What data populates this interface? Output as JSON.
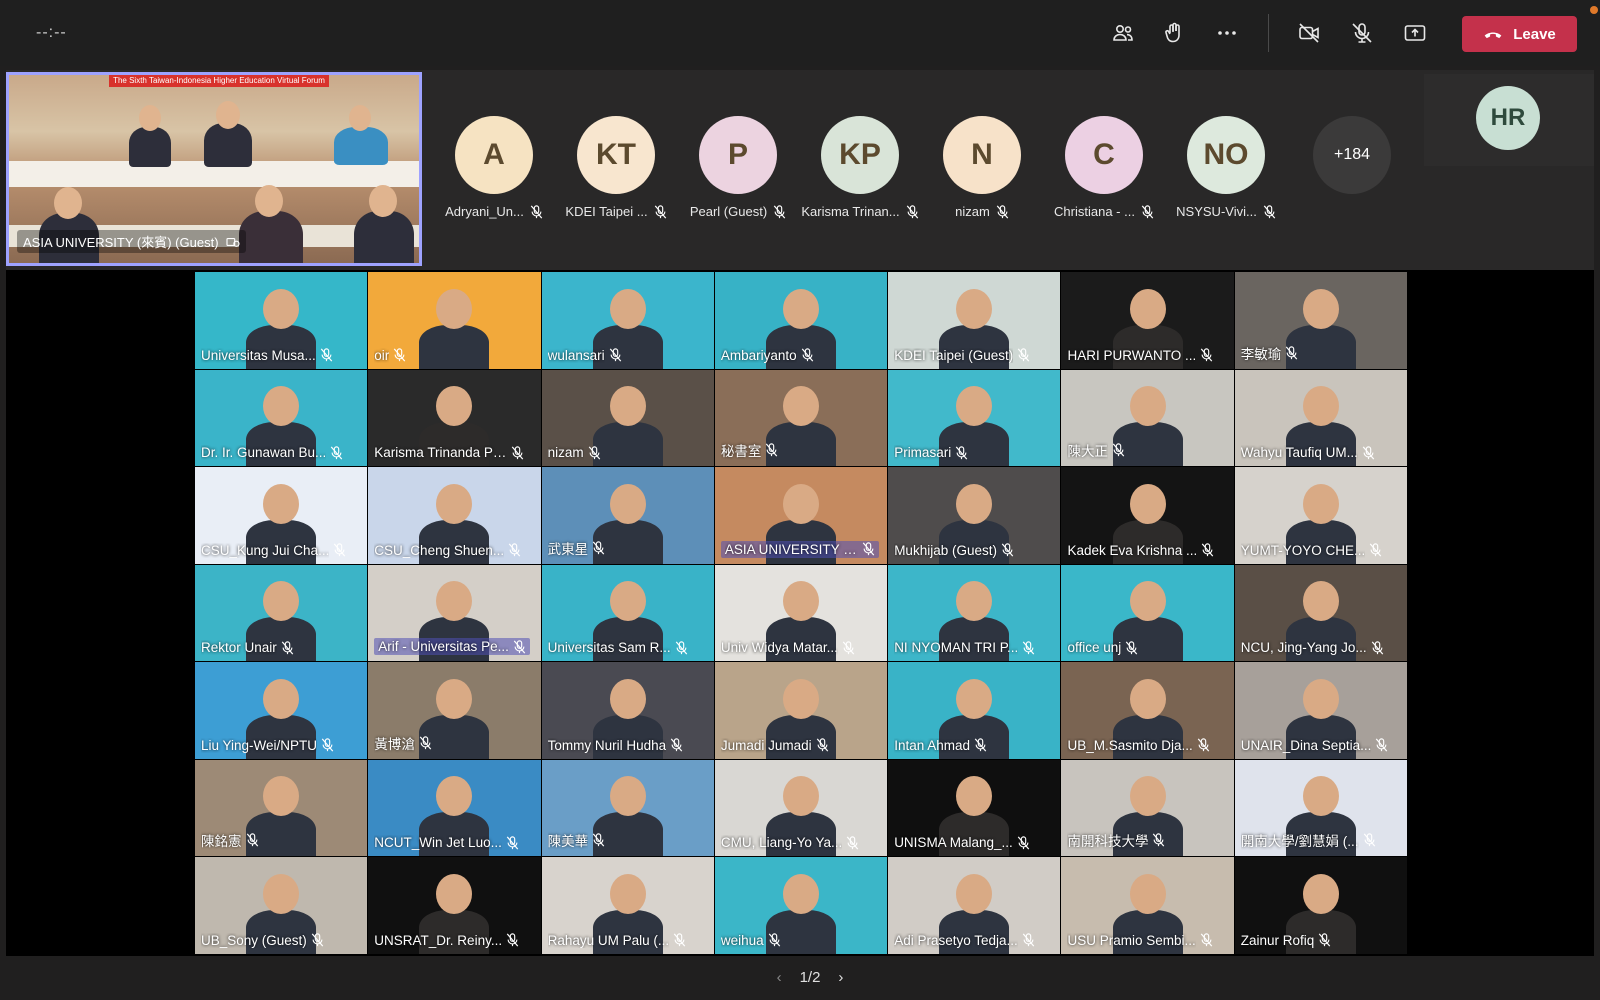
{
  "meeting": {
    "timer": "--:--",
    "leave_label": "Leave",
    "colors": {
      "leave": "#c4314b",
      "featured_border": "#9ea2ff"
    },
    "toolbar_icons": [
      "people-icon",
      "reactions-icon",
      "more-icon",
      "camera-off-icon",
      "mic-off-icon",
      "share-icon"
    ]
  },
  "featured": {
    "banner": "The Sixth Taiwan-Indonesia Higher Education Virtual Forum",
    "label": "ASIA UNIVERSITY (來賓) (Guest)"
  },
  "avatars": [
    {
      "initials": "A",
      "name": "Adryani_Un...",
      "color": "#f6e3c2"
    },
    {
      "initials": "KT",
      "name": "KDEI Taipei ...",
      "color": "#f8e6cf"
    },
    {
      "initials": "P",
      "name": "Pearl (Guest)",
      "color": "#ecd3e0"
    },
    {
      "initials": "KP",
      "name": "Karisma Trinan...",
      "color": "#d9e4d8"
    },
    {
      "initials": "N",
      "name": "nizam",
      "color": "#f7e2c9"
    },
    {
      "initials": "C",
      "name": "Christiana - ...",
      "color": "#ecd0e3"
    },
    {
      "initials": "NO",
      "name": "NSYSU-Vivi...",
      "color": "#dde9dd"
    }
  ],
  "more_count": "+184",
  "self": {
    "initials": "HR"
  },
  "tiles": [
    {
      "name": "Universitas Musa...",
      "bg": "#35b7c9"
    },
    {
      "name": "oir",
      "bg": "#f2a93b"
    },
    {
      "name": "wulansari",
      "bg": "#3bb5cc"
    },
    {
      "name": "Ambariyanto",
      "bg": "#37b2c6"
    },
    {
      "name": "KDEI Taipei (Guest)",
      "bg": "#cfd8d4"
    },
    {
      "name": "HARI PURWANTO ...",
      "bg": "#1b1b1b"
    },
    {
      "name": "李敏瑜",
      "bg": "#6a6560"
    },
    {
      "name": "Dr. Ir. Gunawan Bu...",
      "bg": "#3ab4c9"
    },
    {
      "name": "Karisma Trinanda Pu...",
      "bg": "#2a2a2a"
    },
    {
      "name": "nizam",
      "bg": "#5a5048"
    },
    {
      "name": "秘書室",
      "bg": "#8a6e58"
    },
    {
      "name": "Primasari",
      "bg": "#41b9cb"
    },
    {
      "name": "陳大正",
      "bg": "#c8c6c0"
    },
    {
      "name": "Wahyu Taufiq UM...",
      "bg": "#c9c4bc"
    },
    {
      "name": "CSU_Kung Jui Cha...",
      "bg": "#e9eef6"
    },
    {
      "name": "CSU_Cheng Shuen...",
      "bg": "#c9d6ea"
    },
    {
      "name": "武東星",
      "bg": "#5d8fb8"
    },
    {
      "name": "ASIA UNIVERSITY (...",
      "bg": "#c58a60",
      "boxed": true
    },
    {
      "name": "Mukhijab (Guest)",
      "bg": "#4f4c4c"
    },
    {
      "name": "Kadek Eva Krishna ...",
      "bg": "#141414"
    },
    {
      "name": "YUMT-YOYO CHE...",
      "bg": "#d6d2cc"
    },
    {
      "name": "Rektor Unair",
      "bg": "#3cb4c7"
    },
    {
      "name": "Arif - Universitas Pe...",
      "bg": "#d4cfc8",
      "boxed": true
    },
    {
      "name": "Universitas Sam R...",
      "bg": "#39b3c8"
    },
    {
      "name": "Univ Widya Matar...",
      "bg": "#e4e2de"
    },
    {
      "name": "NI NYOMAN TRI P...",
      "bg": "#3db6c9"
    },
    {
      "name": "office unj",
      "bg": "#3ab7c9"
    },
    {
      "name": "NCU, Jing-Yang Jo...",
      "bg": "#5a4f46"
    },
    {
      "name": "Liu Ying-Wei/NPTU",
      "bg": "#3d9ed4"
    },
    {
      "name": "黃博滄",
      "bg": "#8b7c6a"
    },
    {
      "name": "Tommy Nuril Hudha",
      "bg": "#4a4a52"
    },
    {
      "name": "Jumadi Jumadi",
      "bg": "#b9a48a"
    },
    {
      "name": "Intan Ahmad",
      "bg": "#39b3c7"
    },
    {
      "name": "UB_M.Sasmito Dja...",
      "bg": "#7a6452"
    },
    {
      "name": "UNAIR_Dina Septia...",
      "bg": "#a7a09a"
    },
    {
      "name": "陳銘憲",
      "bg": "#9d8a76"
    },
    {
      "name": "NCUT_Win Jet Luo...",
      "bg": "#3a8bc4"
    },
    {
      "name": "陳美華",
      "bg": "#6a9ec7"
    },
    {
      "name": "CMU, Liang-Yo Ya...",
      "bg": "#d9d7d3"
    },
    {
      "name": "UNISMA Malang_...",
      "bg": "#0f0f0f"
    },
    {
      "name": "南開科技大學",
      "bg": "#c8c4be"
    },
    {
      "name": "開南大學/劉慧娟 (...",
      "bg": "#dfe3ec"
    },
    {
      "name": "UB_Sony (Guest)",
      "bg": "#bfb8ae"
    },
    {
      "name": "UNSRAT_Dr. Reiny...",
      "bg": "#101010"
    },
    {
      "name": "Rahayu UM Palu (...",
      "bg": "#d8d3cd"
    },
    {
      "name": "weihua",
      "bg": "#3bb6c8"
    },
    {
      "name": "Adi Prasetyo Tedja...",
      "bg": "#d1ccc6"
    },
    {
      "name": "USU Pramio Sembi...",
      "bg": "#c7bcae"
    },
    {
      "name": "Zainur Rofiq",
      "bg": "#101010"
    }
  ],
  "pager": {
    "label": "1/2"
  }
}
